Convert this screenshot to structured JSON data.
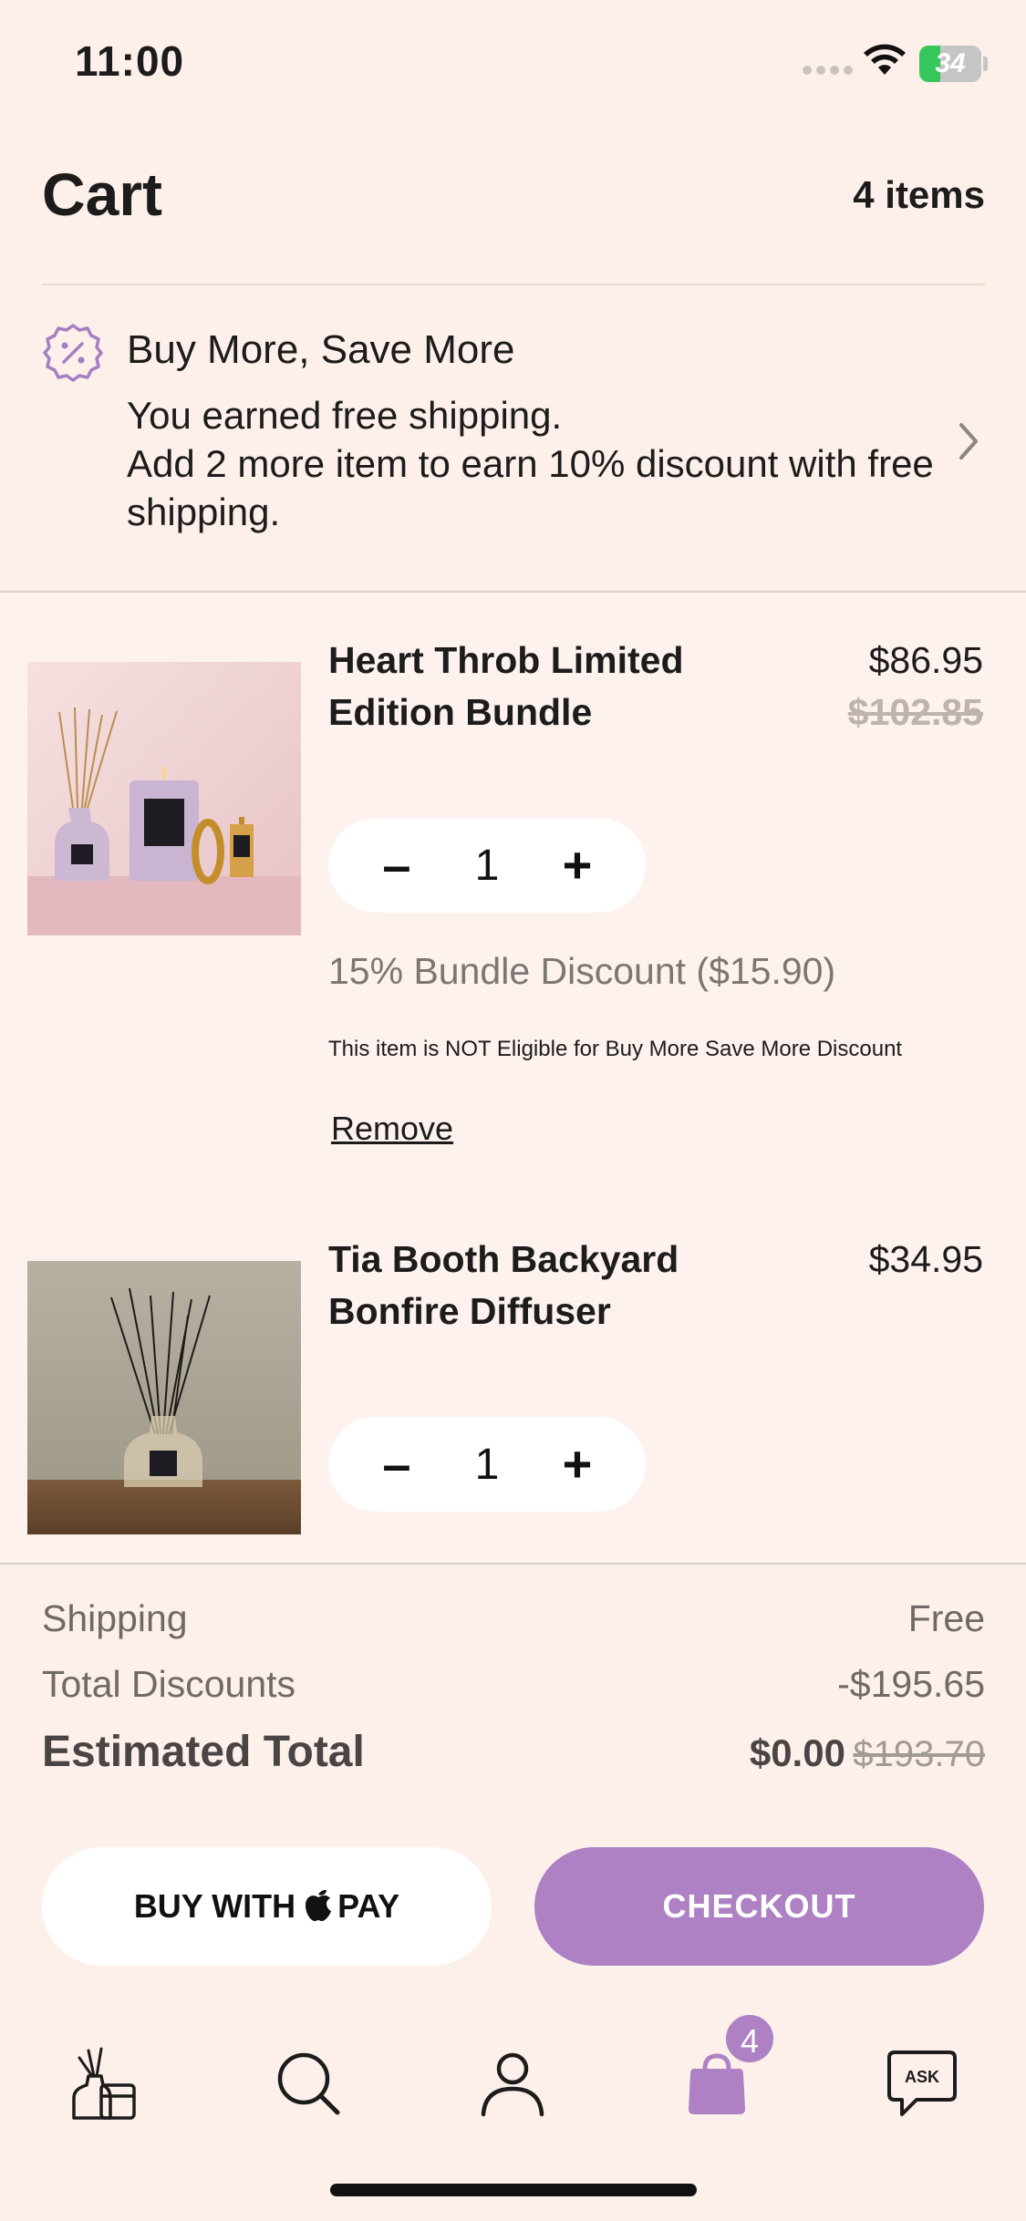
{
  "status_bar": {
    "time": "11:00",
    "battery": "34",
    "battery_level": 0.34
  },
  "header": {
    "title": "Cart",
    "count": "4 items"
  },
  "promo": {
    "title": "Buy More, Save More",
    "line1": "You earned free shipping.",
    "line2": "Add 2 more item to earn 10% discount with free shipping."
  },
  "items": [
    {
      "name": "Heart Throb Limited Edition Bundle",
      "price": "$86.95",
      "original_price": "$102.85",
      "quantity": "1",
      "bundle_discount": "15% Bundle Discount ($15.90)",
      "eligibility_note": "This item is NOT Eligible for Buy More Save More Discount",
      "remove_label": "Remove"
    },
    {
      "name": "Tia Booth Backyard Bonfire Diffuser",
      "price": "$34.95",
      "quantity": "1"
    }
  ],
  "stepper": {
    "minus": "–",
    "plus": "+"
  },
  "summary": {
    "shipping_label": "Shipping",
    "shipping_value": "Free",
    "discounts_label": "Total Discounts",
    "discounts_value": "-$195.65",
    "total_label": "Estimated Total",
    "total_value": "$0.00",
    "total_original": "$193.70"
  },
  "buttons": {
    "apple_pay_prefix": "BUY WITH",
    "apple_pay_suffix": "PAY",
    "checkout": "CHECKOUT"
  },
  "tab_bar": {
    "cart_badge": "4",
    "ask_label": "ASK",
    "accent": "#ad81c4"
  }
}
